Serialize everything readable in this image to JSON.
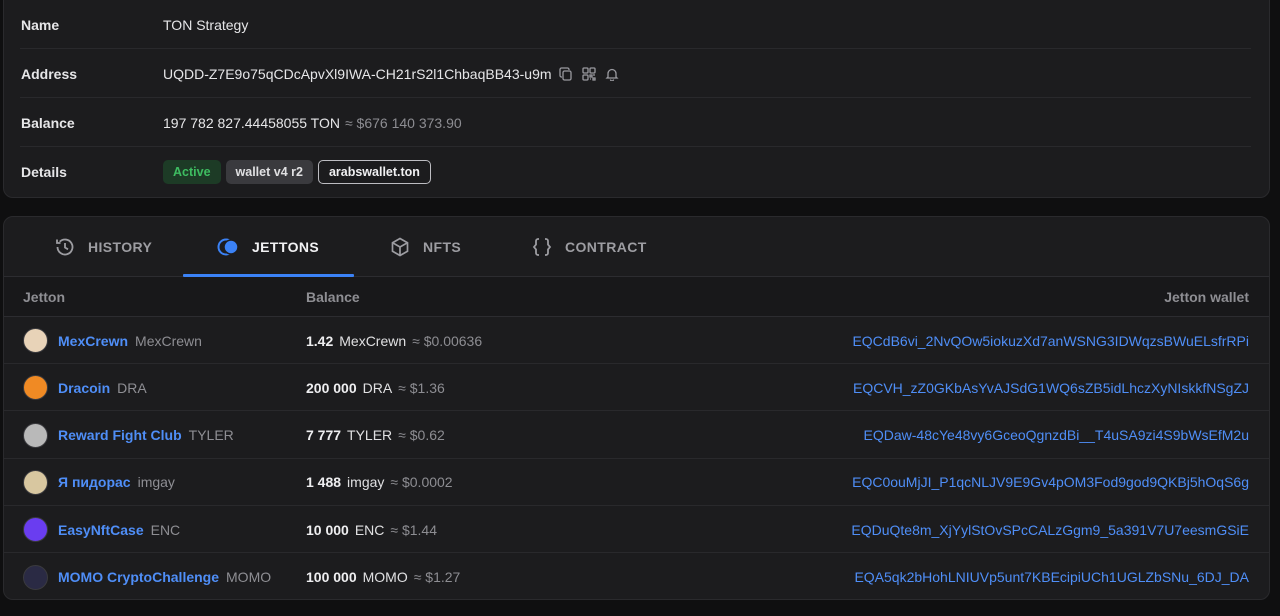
{
  "account": {
    "name_label": "Name",
    "name_value": "TON Strategy",
    "address_label": "Address",
    "address_value": "UQDD-Z7E9o75qCDcApvXl9IWA-CH21rS2l1ChbaqBB43-u9m",
    "balance_label": "Balance",
    "balance_ton": "197 782 827.44458055 TON",
    "balance_usd": "≈ $676 140 373.90",
    "details_label": "Details",
    "badges": [
      "Active",
      "wallet v4 r2",
      "arabswallet.ton"
    ]
  },
  "tabs": [
    {
      "label": "HISTORY",
      "icon": "history-icon"
    },
    {
      "label": "JETTONS",
      "icon": "jettons-icon"
    },
    {
      "label": "NFTS",
      "icon": "nfts-icon"
    },
    {
      "label": "CONTRACT",
      "icon": "contract-icon"
    }
  ],
  "active_tab": "JETTONS",
  "table": {
    "headers": [
      "Jetton",
      "Balance",
      "Jetton wallet"
    ],
    "rows": [
      {
        "name": "MexCrewn",
        "symbol": "MexCrewn",
        "amount": "1.42",
        "unit": "MexCrewn",
        "usd": "≈ $0.00636",
        "wallet": "EQCdB6vi_2NvQOw5iokuzXd7anWSNG3IDWqzsBWuELsfrRPi",
        "avatar_color": "#e8d3b8"
      },
      {
        "name": "Dracoin",
        "symbol": "DRA",
        "amount": "200 000",
        "unit": "DRA",
        "usd": "≈ $1.36",
        "wallet": "EQCVH_zZ0GKbAsYvAJSdG1WQ6sZB5idLhczXyNIskkfNSgZJ",
        "avatar_color": "#f08a24"
      },
      {
        "name": "Reward Fight Club",
        "symbol": "TYLER",
        "amount": "7 777",
        "unit": "TYLER",
        "usd": "≈ $0.62",
        "wallet": "EQDaw-48cYe48vy6GceoQgnzdBi__T4uSA9zi4S9bWsEfM2u",
        "avatar_color": "#b9b9b9"
      },
      {
        "name": "Я пидорас",
        "symbol": "imgay",
        "amount": "1 488",
        "unit": "imgay",
        "usd": "≈ $0.0002",
        "wallet": "EQC0ouMjJI_P1qcNLJV9E9Gv4pOM3Fod9god9QKBj5hOqS6g",
        "avatar_color": "#d8c7a0"
      },
      {
        "name": "EasyNftCase",
        "symbol": "ENC",
        "amount": "10 000",
        "unit": "ENC",
        "usd": "≈ $1.44",
        "wallet": "EQDuQte8m_XjYylStOvSPcCALzGgm9_5a391V7U7eesmGSiE",
        "avatar_color": "#6a3df0"
      },
      {
        "name": "MOMO CryptoChallenge",
        "symbol": "MOMO",
        "amount": "100 000",
        "unit": "MOMO",
        "usd": "≈ $1.27",
        "wallet": "EQA5qk2bHohLNIUVp5unt7KBEcipiUCh1UGLZbSNu_6DJ_DA",
        "avatar_color": "#2a2a44"
      }
    ]
  },
  "colors": {
    "accent": "#3b82f6",
    "link": "#4f8ef7",
    "active_badge": "#3ebd61"
  }
}
